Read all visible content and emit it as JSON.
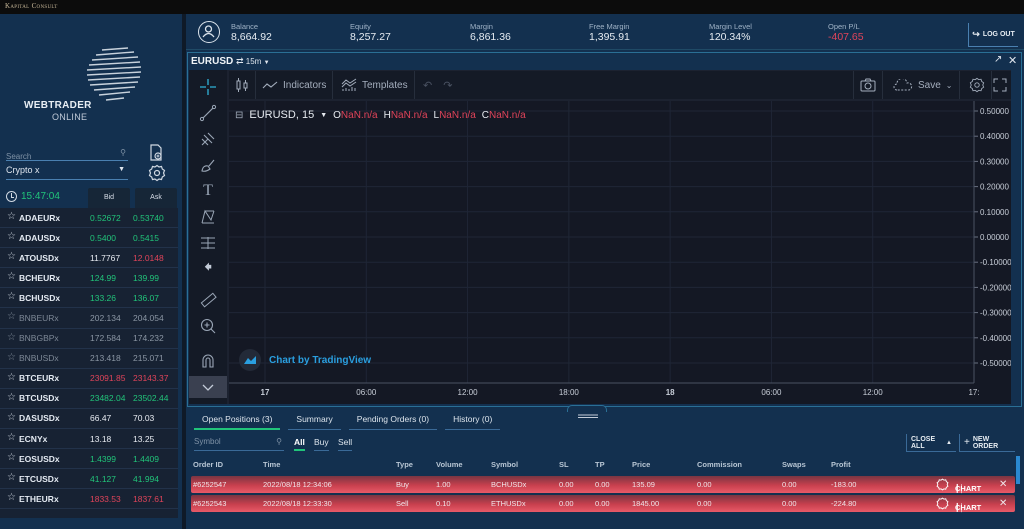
{
  "brand": "Kapital Consult",
  "logo": {
    "line1": "WEBTRADER",
    "line2": "ONLINE"
  },
  "sidebar": {
    "search_placeholder": "Search",
    "category": "Crypto x",
    "time": "15:47:04",
    "bid_label": "Bid",
    "ask_label": "Ask",
    "watchlist": [
      {
        "symbol": "ADAEURx",
        "bid": "0.52672",
        "ask": "0.53740",
        "bid_color": "green",
        "ask_color": "green",
        "dim": false
      },
      {
        "symbol": "ADAUSDx",
        "bid": "0.5400",
        "ask": "0.5415",
        "bid_color": "green",
        "ask_color": "green",
        "dim": false
      },
      {
        "symbol": "ATOUSDx",
        "bid": "11.7767",
        "ask": "12.0148",
        "bid_color": "white",
        "ask_color": "red",
        "dim": false
      },
      {
        "symbol": "BCHEURx",
        "bid": "124.99",
        "ask": "139.99",
        "bid_color": "green",
        "ask_color": "green",
        "dim": false
      },
      {
        "symbol": "BCHUSDx",
        "bid": "133.26",
        "ask": "136.07",
        "bid_color": "green",
        "ask_color": "green",
        "dim": false
      },
      {
        "symbol": "BNBEURx",
        "bid": "202.134",
        "ask": "204.054",
        "bid_color": "grey",
        "ask_color": "grey",
        "dim": true
      },
      {
        "symbol": "BNBGBPx",
        "bid": "172.584",
        "ask": "174.232",
        "bid_color": "grey",
        "ask_color": "grey",
        "dim": true
      },
      {
        "symbol": "BNBUSDx",
        "bid": "213.418",
        "ask": "215.071",
        "bid_color": "grey",
        "ask_color": "grey",
        "dim": true
      },
      {
        "symbol": "BTCEURx",
        "bid": "23091.85",
        "ask": "23143.37",
        "bid_color": "red",
        "ask_color": "red",
        "dim": false
      },
      {
        "symbol": "BTCUSDx",
        "bid": "23482.04",
        "ask": "23502.44",
        "bid_color": "green",
        "ask_color": "green",
        "dim": false
      },
      {
        "symbol": "DASUSDx",
        "bid": "66.47",
        "ask": "70.03",
        "bid_color": "white",
        "ask_color": "white",
        "dim": false
      },
      {
        "symbol": "ECNYx",
        "bid": "13.18",
        "ask": "13.25",
        "bid_color": "white",
        "ask_color": "white",
        "dim": false
      },
      {
        "symbol": "EOSUSDx",
        "bid": "1.4399",
        "ask": "1.4409",
        "bid_color": "green",
        "ask_color": "green",
        "dim": false
      },
      {
        "symbol": "ETCUSDx",
        "bid": "41.127",
        "ask": "41.994",
        "bid_color": "green",
        "ask_color": "green",
        "dim": false
      },
      {
        "symbol": "ETHEURx",
        "bid": "1833.53",
        "ask": "1837.61",
        "bid_color": "red",
        "ask_color": "red",
        "dim": false
      }
    ]
  },
  "account": {
    "balance": {
      "label": "Balance",
      "value": "8,664.92"
    },
    "equity": {
      "label": "Equity",
      "value": "8,257.27"
    },
    "margin": {
      "label": "Margin",
      "value": "6,861.36"
    },
    "free_margin": {
      "label": "Free Margin",
      "value": "1,395.91"
    },
    "margin_level": {
      "label": "Margin Level",
      "value": "120.34%"
    },
    "open_pl": {
      "label": "Open P/L",
      "value": "-407.65"
    },
    "logout_label": "LOG OUT"
  },
  "chart": {
    "symbol": "EURUSD",
    "timeframe": "15m",
    "toolbar": {
      "indicators": "Indicators",
      "templates": "Templates",
      "save": "Save"
    },
    "legend": {
      "title": "EURUSD, 15",
      "o_label": "O",
      "o": "NaN.n/a",
      "h_label": "H",
      "h": "NaN.n/a",
      "l_label": "L",
      "l": "NaN.n/a",
      "c_label": "C",
      "c": "NaN.n/a"
    },
    "attribution": "Chart by TradingView",
    "price_ticks": [
      "0.50000",
      "0.40000",
      "0.30000",
      "0.20000",
      "0.10000",
      "0.00000",
      "-0.10000",
      "-0.20000",
      "-0.30000",
      "-0.40000",
      "-0.50000"
    ],
    "time_ticks": [
      {
        "label": "17",
        "bold": true
      },
      {
        "label": "06:00",
        "bold": false
      },
      {
        "label": "12:00",
        "bold": false
      },
      {
        "label": "18:00",
        "bold": false
      },
      {
        "label": "18",
        "bold": true
      },
      {
        "label": "06:00",
        "bold": false
      },
      {
        "label": "12:00",
        "bold": false
      },
      {
        "label": "17:",
        "bold": false
      }
    ]
  },
  "positions": {
    "tabs": [
      "Open Positions (3)",
      "Summary",
      "Pending Orders (0)",
      "History (0)"
    ],
    "search_placeholder": "Symbol",
    "filters": [
      "All",
      "Buy",
      "Sell"
    ],
    "close_all_label": "CLOSE ALL",
    "new_order_label": "NEW ORDER",
    "columns": [
      "Order ID",
      "Time",
      "Type",
      "Volume",
      "Symbol",
      "SL",
      "TP",
      "Price",
      "Commission",
      "Swaps",
      "Profit"
    ],
    "chart_label": "CHART",
    "rows": [
      {
        "order_id": "#6252547",
        "time": "2022/08/18 12:34:06",
        "type": "Buy",
        "volume": "1.00",
        "symbol": "BCHUSDx",
        "sl": "0.00",
        "tp": "0.00",
        "price": "135.09",
        "commission": "0.00",
        "swaps": "0.00",
        "profit": "-183.00"
      },
      {
        "order_id": "#6252543",
        "time": "2022/08/18 12:33:30",
        "type": "Sell",
        "volume": "0.10",
        "symbol": "ETHUSDx",
        "sl": "0.00",
        "tp": "0.00",
        "price": "1845.00",
        "commission": "0.00",
        "swaps": "0.00",
        "profit": "-224.80"
      }
    ]
  }
}
